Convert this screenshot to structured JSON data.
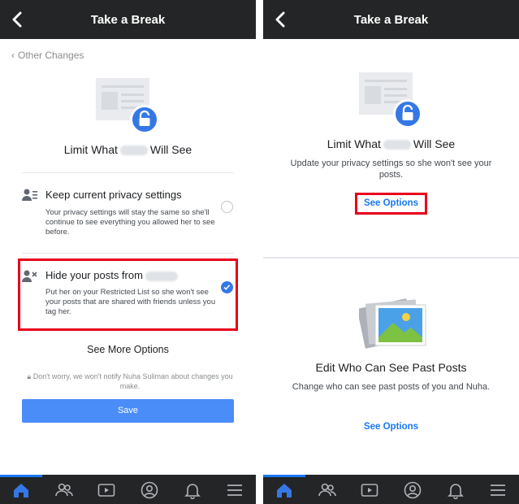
{
  "left": {
    "header_title": "Take a Break",
    "back_link": "Other Changes",
    "heading_prefix": "Limit What",
    "heading_suffix": "Will See",
    "option1": {
      "title": "Keep current privacy settings",
      "desc": "Your privacy settings will stay the same so she'll continue to see everything you allowed her to see before."
    },
    "option2": {
      "title_prefix": "Hide your posts from",
      "desc": "Put her on your Restricted List so she won't see your posts that are shared with friends unless you tag her."
    },
    "more_options": "See More Options",
    "notify": "Don't worry, we won't notify Nuha Suliman about changes you make.",
    "save": "Save"
  },
  "right": {
    "header_title": "Take a Break",
    "section1": {
      "heading_prefix": "Limit What",
      "heading_suffix": "Will See",
      "desc": "Update your privacy settings so she won't see your posts.",
      "link": "See Options"
    },
    "section2": {
      "heading": "Edit Who Can See Past Posts",
      "desc": "Change who can see past posts of you and Nuha.",
      "link": "See Options"
    }
  },
  "tabs": [
    "home-icon",
    "friends-icon",
    "watch-icon",
    "profile-icon",
    "notifications-icon",
    "menu-icon"
  ],
  "colors": {
    "accent": "#1877f2",
    "highlight": "#e8001c",
    "bar": "#242526"
  }
}
